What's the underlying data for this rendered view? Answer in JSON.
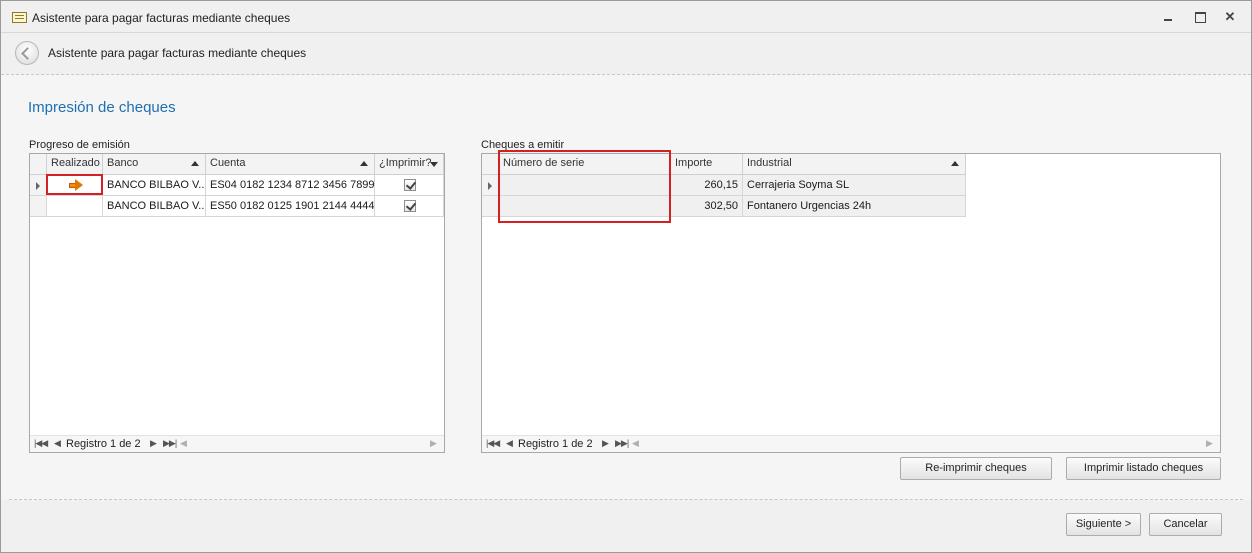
{
  "window": {
    "title": "Asistente para pagar facturas mediante cheques"
  },
  "wizard": {
    "header_title": "Asistente para pagar facturas mediante cheques",
    "page_title": "Impresión de cheques"
  },
  "left_panel": {
    "label": "Progreso de emisión",
    "columns": [
      "Realizado",
      "Banco",
      "Cuenta",
      "¿Imprimir?"
    ],
    "rows": [
      {
        "realizado_icon": "orange-arrow-icon",
        "banco": "BANCO BILBAO V...",
        "cuenta": "ES04 0182 1234 8712 3456 7899",
        "imprimir": true,
        "current": true
      },
      {
        "realizado_icon": "",
        "banco": "BANCO BILBAO V...",
        "cuenta": "ES50 0182 0125 1901 2144 4444",
        "imprimir": true,
        "current": false
      }
    ],
    "navigator": "Registro 1 de 2"
  },
  "right_panel": {
    "label": "Cheques a emitir",
    "columns": [
      "Número de serie",
      "Importe",
      "Industrial"
    ],
    "rows": [
      {
        "numero_serie": "",
        "importe": "260,15",
        "industrial": "Cerrajeria Soyma SL",
        "current": true
      },
      {
        "numero_serie": "",
        "importe": "302,50",
        "industrial": "Fontanero Urgencias 24h",
        "current": false
      }
    ],
    "navigator": "Registro 1 de 2"
  },
  "buttons": {
    "reprint": "Re-imprimir cheques",
    "print_list": "Imprimir listado cheques",
    "next": "Siguiente >",
    "cancel": "Cancelar"
  },
  "colors": {
    "accent_title": "#1f6fb1",
    "highlight_box": "#d32020",
    "status_arrow": "#f08a16"
  }
}
